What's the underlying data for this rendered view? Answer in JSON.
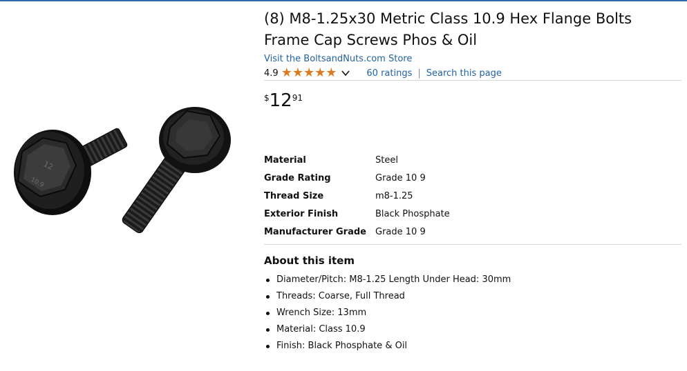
{
  "product": {
    "title_line1": "(8) M8-1.25x30 Metric Class 10.9 Hex Flange Bolts",
    "title_line2": "Frame Cap Screws Phos & Oil",
    "store_link": "Visit the BoltsandNuts.com Store",
    "head_marking_top": "12",
    "head_marking_bottom": "10.9"
  },
  "rating": {
    "value": "4.9",
    "stars": 4.9,
    "star_color": "#de7921",
    "count_label": "60 ratings",
    "separator": "|",
    "search_label": "Search this page"
  },
  "price": {
    "symbol": "$",
    "whole": "12",
    "fraction": "91"
  },
  "specs": [
    {
      "key": "Material",
      "value": "Steel"
    },
    {
      "key": "Grade Rating",
      "value": "Grade 10 9"
    },
    {
      "key": "Thread Size",
      "value": "m8-1.25"
    },
    {
      "key": "Exterior Finish",
      "value": "Black Phosphate"
    },
    {
      "key": "Manufacturer Grade",
      "value": "Grade 10 9"
    }
  ],
  "about": {
    "title": "About this item",
    "bullets": [
      "Diameter/Pitch: M8-1.25 Length Under Head: 30mm",
      "Threads: Coarse, Full Thread",
      "Wrench Size: 13mm",
      "Material: Class 10.9",
      "Finish: Black Phosphate & Oil"
    ]
  },
  "colors": {
    "link": "#2162a1",
    "accent_rule": "#2a6ab5",
    "text": "#0f1111",
    "divider": "#d5d9d9"
  },
  "icons": {
    "rating_dropdown": "chevron-down-icon",
    "star": "star-icon"
  }
}
